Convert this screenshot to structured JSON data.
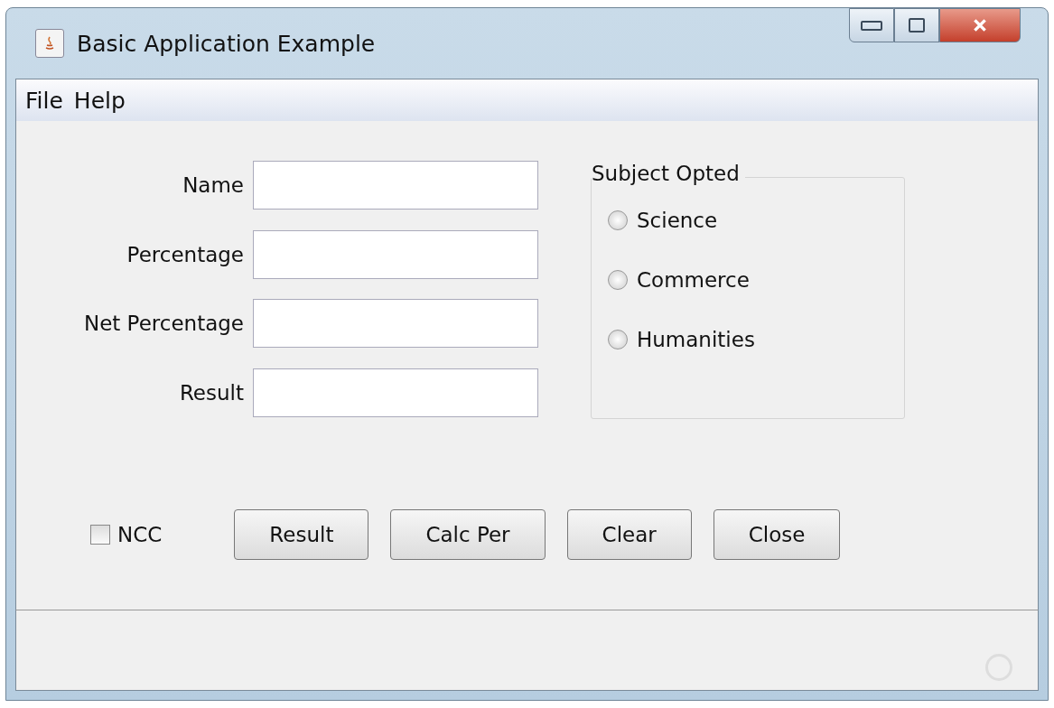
{
  "window": {
    "title": "Basic Application Example"
  },
  "menu": [
    "File",
    "Help"
  ],
  "form": {
    "fields": [
      {
        "label": "Name"
      },
      {
        "label": "Percentage"
      },
      {
        "label": "Net Percentage"
      },
      {
        "label": "Result"
      }
    ]
  },
  "subject_group": {
    "title": "Subject Opted",
    "options": [
      {
        "label": "Science",
        "selected": false
      },
      {
        "label": "Commerce",
        "selected": false
      },
      {
        "label": "Humanities",
        "selected": false
      }
    ]
  },
  "ncc": {
    "label": "NCC",
    "checked": false
  },
  "buttons": [
    "Result",
    "Calc Per",
    "Clear",
    "Close"
  ]
}
